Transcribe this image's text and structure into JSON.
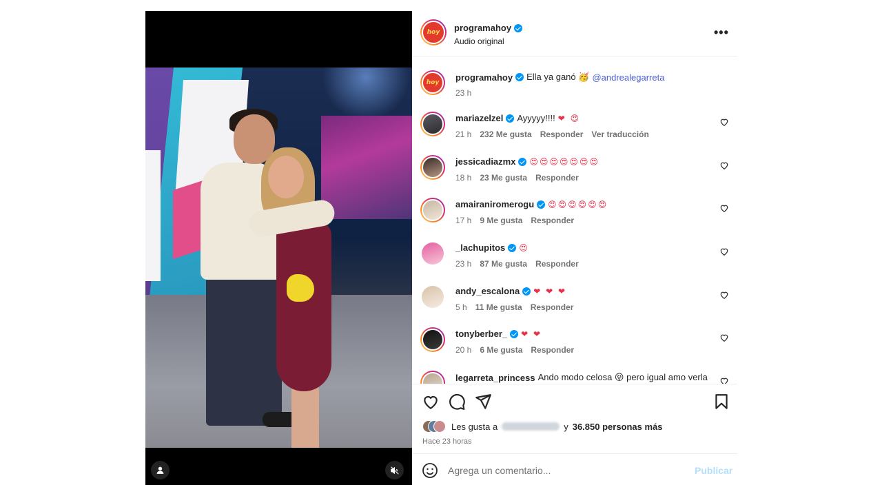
{
  "post": {
    "username": "programahoy",
    "subtitle": "Audio original",
    "logo_text": "hoy",
    "more_label": "•••",
    "caption": {
      "username": "programahoy",
      "text": "Ella ya ganó 🥳",
      "mention": "@andrealegarreta",
      "time": "23 h"
    }
  },
  "comments": [
    {
      "username": "mariazelzel",
      "text": "Ayyyyy!!!!",
      "emoji": "❤ 😍",
      "time": "21 h",
      "likes": "232 Me gusta",
      "reply": "Responder",
      "translate": "Ver traducción"
    },
    {
      "username": "jessicadiazmx",
      "text": "",
      "emoji": "😍😍😍😍😍😍😍",
      "time": "18 h",
      "likes": "23 Me gusta",
      "reply": "Responder"
    },
    {
      "username": "amairaniromerogu",
      "text": "",
      "emoji": "😍😍😍😍😍😍",
      "time": "17 h",
      "likes": "9 Me gusta",
      "reply": "Responder"
    },
    {
      "username": "_lachupitos",
      "text": "",
      "emoji": "😍",
      "time": "23 h",
      "likes": "87 Me gusta",
      "reply": "Responder"
    },
    {
      "username": "andy_escalona",
      "text": "",
      "emoji": "❤ ❤ ❤",
      "time": "5 h",
      "likes": "11 Me gusta",
      "reply": "Responder"
    },
    {
      "username": "tonyberber_",
      "text": "",
      "emoji": "❤ ❤",
      "time": "20 h",
      "likes": "6 Me gusta",
      "reply": "Responder"
    },
    {
      "username": "legarreta_princess",
      "text": "Ando modo celosa 😝 pero igual amo verla",
      "emoji": "",
      "time": "",
      "likes": "",
      "reply": ""
    }
  ],
  "footer": {
    "likes_prefix": "Les gusta a",
    "likes_suffix": "y",
    "likes_count": "36.850 personas más",
    "time_ago": "Hace 23 horas"
  },
  "add_comment": {
    "placeholder": "Agrega un comentario...",
    "publish_label": "Publicar"
  },
  "colors": {
    "accent": "#0095f6",
    "publish_disabled": "#b2dffc",
    "heart": "#e8324b"
  }
}
